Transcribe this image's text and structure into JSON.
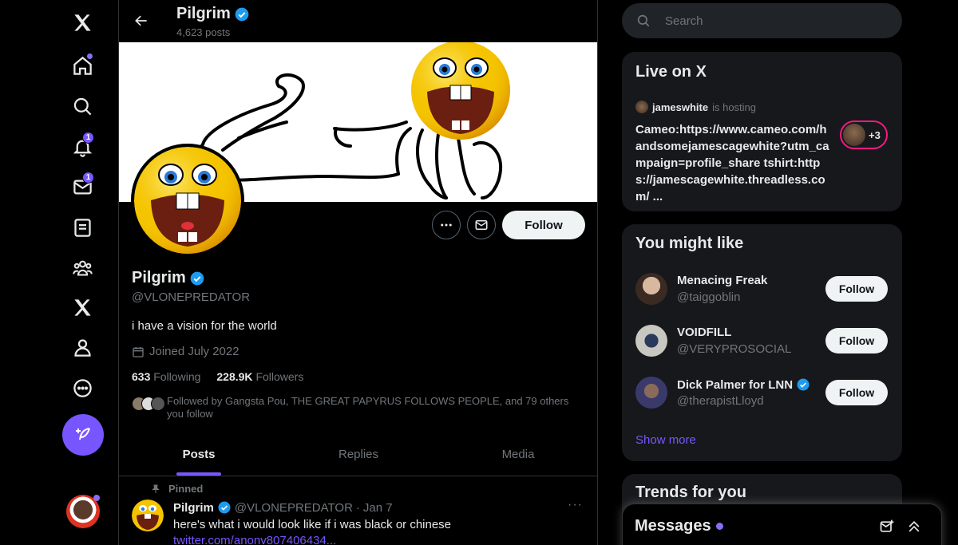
{
  "colors": {
    "accent": "#7856ff",
    "verified": "#1d9bf0",
    "live": "#f91880",
    "background": "#000000"
  },
  "nav": {
    "items": [
      {
        "name": "x-logo-icon"
      },
      {
        "name": "home-icon"
      },
      {
        "name": "search-icon"
      },
      {
        "name": "notifications-icon",
        "badge": "1"
      },
      {
        "name": "messages-icon",
        "badge": "1"
      },
      {
        "name": "lists-icon"
      },
      {
        "name": "communities-icon"
      },
      {
        "name": "premium-icon"
      },
      {
        "name": "profile-icon"
      },
      {
        "name": "more-icon"
      }
    ],
    "post_button_icon": "feather-plus-icon"
  },
  "header": {
    "name": "Pilgrim",
    "posts_count": "4,623 posts"
  },
  "profile": {
    "name": "Pilgrim",
    "handle": "@VLONEPREDATOR",
    "bio": "i have a vision for the world",
    "joined": "Joined July 2022",
    "following_count": "633",
    "following_label": "Following",
    "followers_count": "228.9K",
    "followers_label": "Followers",
    "followed_by": "Followed by Gangsta Pou, THE GREAT PAPYRUS FOLLOWS PEOPLE, and 79 others you follow",
    "follow_button": "Follow"
  },
  "tabs": [
    {
      "label": "Posts",
      "active": true
    },
    {
      "label": "Replies",
      "active": false
    },
    {
      "label": "Media",
      "active": false
    }
  ],
  "tweet": {
    "pinned_label": "Pinned",
    "name": "Pilgrim",
    "handle": "@VLONEPREDATOR",
    "separator": "·",
    "date": "Jan 7",
    "text": "here's what i would look like if i was black or chinese",
    "link": "twitter.com/anonv807406434..."
  },
  "search": {
    "placeholder": "Search"
  },
  "live": {
    "title": "Live on X",
    "host_name": "jameswhite",
    "host_status": "is hosting",
    "text": "Cameo:https://www.cameo.com/handsomejamescagewhite?utm_campaign=profile_share tshirt:https://jamescagewhite.threadless.com/ ...",
    "listener_count": "+3"
  },
  "you_might_like": {
    "title": "You might like",
    "users": [
      {
        "name": "Menacing Freak",
        "handle": "@taiggoblin",
        "verified": false,
        "button": "Follow"
      },
      {
        "name": "VOIDFILL",
        "handle": "@VERYPROSOCIAL",
        "verified": false,
        "button": "Follow"
      },
      {
        "name": "Dick Palmer for LNN",
        "handle": "@therapistLloyd",
        "verified": true,
        "button": "Follow"
      }
    ],
    "show_more": "Show more"
  },
  "trends": {
    "title": "Trends for you"
  },
  "messages": {
    "title": "Messages"
  }
}
